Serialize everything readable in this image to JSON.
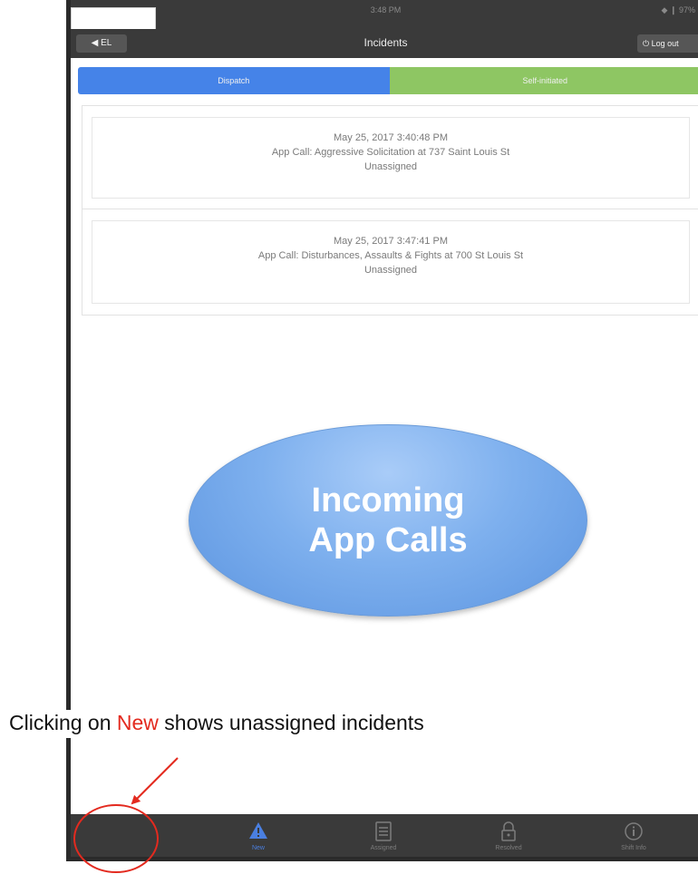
{
  "statusbar": {
    "time": "3:48 PM",
    "battery": "◆ ❙ 97%"
  },
  "navbar": {
    "back_label": "◀ EL",
    "title": "Incidents",
    "logout_label": "⏻ Log out"
  },
  "segments": {
    "dispatch": "Dispatch",
    "self_initiated": "Self-initiated"
  },
  "incidents": [
    {
      "datetime": "May 25, 2017 3:40:48 PM",
      "description": "App Call: Aggressive Solicitation at 737 Saint Louis St",
      "status": "Unassigned"
    },
    {
      "datetime": "May 25, 2017 3:47:41 PM",
      "description": "App Call: Disturbances, Assaults & Fights at 700 St Louis St",
      "status": "Unassigned"
    }
  ],
  "callout": {
    "line1": "Incoming",
    "line2": "App Calls"
  },
  "annotation": {
    "prefix": "Clicking on ",
    "highlight": "New",
    "suffix": " shows unassigned incidents"
  },
  "tabs": [
    {
      "label": "New",
      "icon": "warning-triangle-icon"
    },
    {
      "label": "Assigned",
      "icon": "document-icon"
    },
    {
      "label": "Resolved",
      "icon": "lock-icon"
    },
    {
      "label": "Shift Info",
      "icon": "info-icon"
    }
  ],
  "colors": {
    "dispatch": "#4583e8",
    "self_initiated": "#8ec663",
    "highlight": "#e32a1f",
    "callout": "#7eb0ee",
    "bar": "#3a3a3a"
  }
}
